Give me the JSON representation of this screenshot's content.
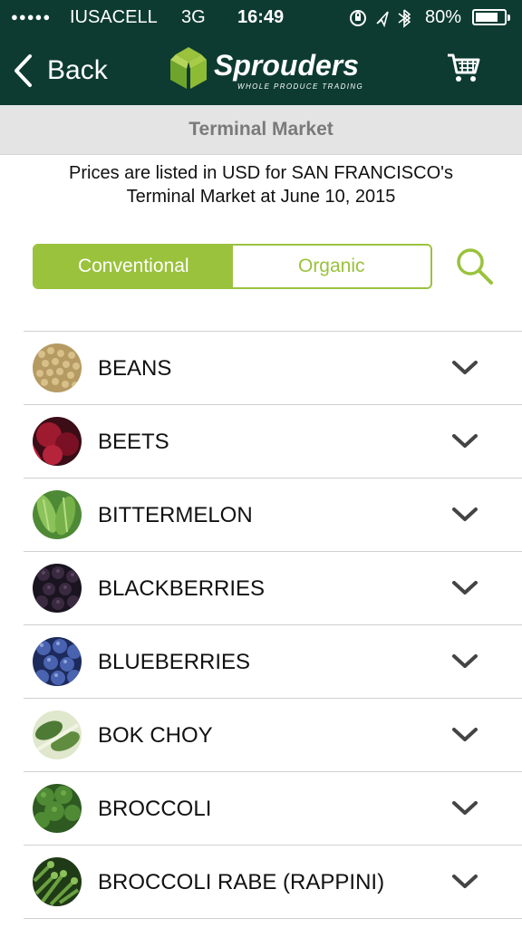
{
  "status_bar": {
    "signal": "●●●●●",
    "carrier": "IUSACELL",
    "network": "3G",
    "time": "16:49",
    "battery_percent": "80%",
    "battery_level": 0.8
  },
  "nav": {
    "back_label": "Back",
    "logo_text": "Sprouders",
    "logo_tagline": "WHOLE PRODUCE TRADING"
  },
  "section_title": "Terminal Market",
  "notice": "Prices are listed in USD for SAN FRANCISCO's Terminal Market at June 10, 2015",
  "segment": {
    "options": [
      "Conventional",
      "Organic"
    ],
    "selected": "Conventional"
  },
  "colors": {
    "header": "#0d3b31",
    "accent": "#9ac23c"
  },
  "products": [
    {
      "name": "BEANS",
      "thumb": "beans-photo"
    },
    {
      "name": "BEETS",
      "thumb": "beets-photo"
    },
    {
      "name": "BITTERMELON",
      "thumb": "bittermelon-photo"
    },
    {
      "name": "BLACKBERRIES",
      "thumb": "blackberries-photo"
    },
    {
      "name": "BLUEBERRIES",
      "thumb": "blueberries-photo"
    },
    {
      "name": "BOK CHOY",
      "thumb": "bok-choy-photo"
    },
    {
      "name": "BROCCOLI",
      "thumb": "broccoli-photo"
    },
    {
      "name": "BROCCOLI RABE (RAPPINI)",
      "thumb": "broccoli-rabe-photo"
    }
  ]
}
